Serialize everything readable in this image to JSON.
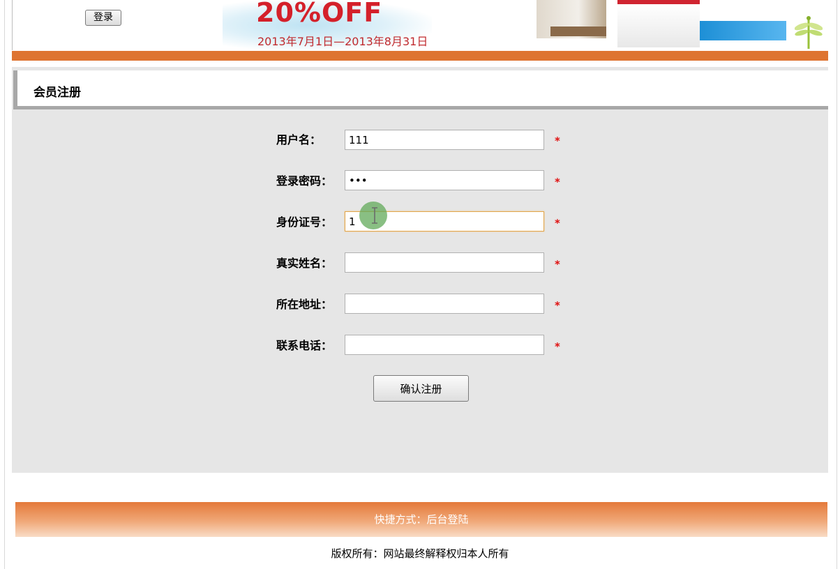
{
  "header": {
    "login_button": "登录",
    "banner": {
      "sale_text": "20%OFF",
      "date_text": "2013年7月1日—2013年8月31日"
    }
  },
  "section": {
    "title": "会员注册"
  },
  "form": {
    "username": {
      "label": "用户名：",
      "value": "111"
    },
    "password": {
      "label": "登录密码：",
      "value": "111"
    },
    "id_number": {
      "label": "身份证号：",
      "value": "1"
    },
    "real_name": {
      "label": "真实姓名：",
      "value": ""
    },
    "address": {
      "label": "所在地址：",
      "value": ""
    },
    "phone": {
      "label": "联系电话：",
      "value": ""
    },
    "required_mark": "*",
    "submit_label": "确认注册"
  },
  "footer": {
    "links_text": "快捷方式：后台登陆",
    "copyright": "版权所有：网站最终解释权归本人所有"
  },
  "colors": {
    "accent_orange": "#de7431",
    "required_red": "#e01010",
    "panel_gray": "#e6e6e6"
  }
}
